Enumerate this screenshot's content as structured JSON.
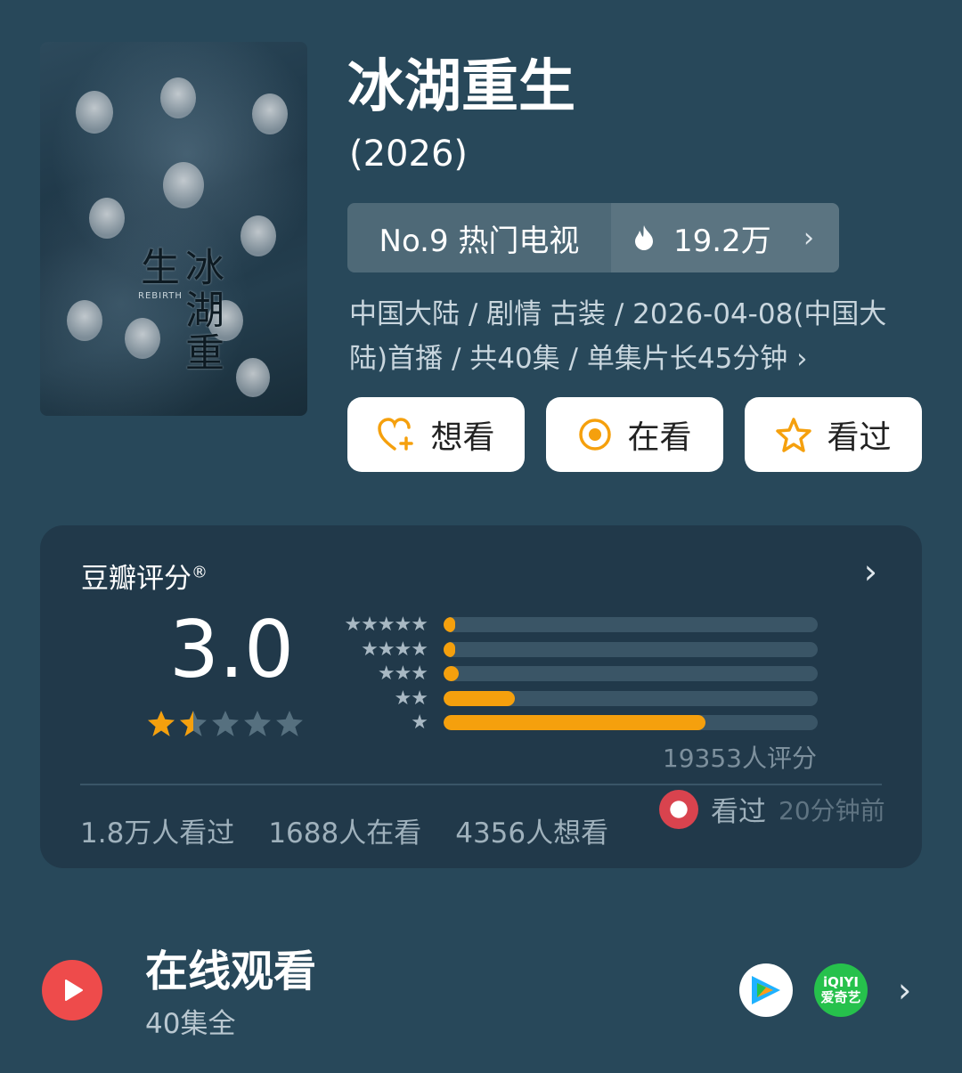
{
  "title": "冰湖重生",
  "year": "(2026)",
  "poster": {
    "calligraphy": "冰湖重生",
    "english": "REBIRTH"
  },
  "rank": {
    "label": "No.9 热门电视",
    "heat": "19.2万"
  },
  "meta": "中国大陆 / 剧情 古装 / 2026-04-08(中国大陆)首播 / 共40集 / 单集片长45分钟 ›",
  "actions": [
    {
      "label": "想看",
      "icon": "heart-plus-icon"
    },
    {
      "label": "在看",
      "icon": "target-circle-icon"
    },
    {
      "label": "看过",
      "icon": "star-outline-icon"
    }
  ],
  "rating": {
    "label": "豆瓣评分",
    "registered": "®",
    "score": "3.0",
    "stars": 1.5,
    "distribution": [
      {
        "stars": "★★★★★",
        "percent": 3
      },
      {
        "stars": "★★★★",
        "percent": 2
      },
      {
        "stars": "★★★",
        "percent": 4
      },
      {
        "stars": "★★",
        "percent": 19
      },
      {
        "stars": "★",
        "percent": 70
      }
    ],
    "votes": "19353人评分",
    "counts": [
      "1.8万人看过",
      "1688人在看",
      "4356人想看"
    ],
    "friend": {
      "action": "看过",
      "time": "20分钟前"
    }
  },
  "online": {
    "title": "在线观看",
    "subtitle": "40集全",
    "providers": [
      "tencent-video-icon",
      "iqiyi-icon"
    ],
    "iqiyi_text": "iQIYI爱奇艺"
  },
  "colors": {
    "background": "#28485a",
    "accent": "#f5a00d",
    "play": "#ee4b4b"
  }
}
